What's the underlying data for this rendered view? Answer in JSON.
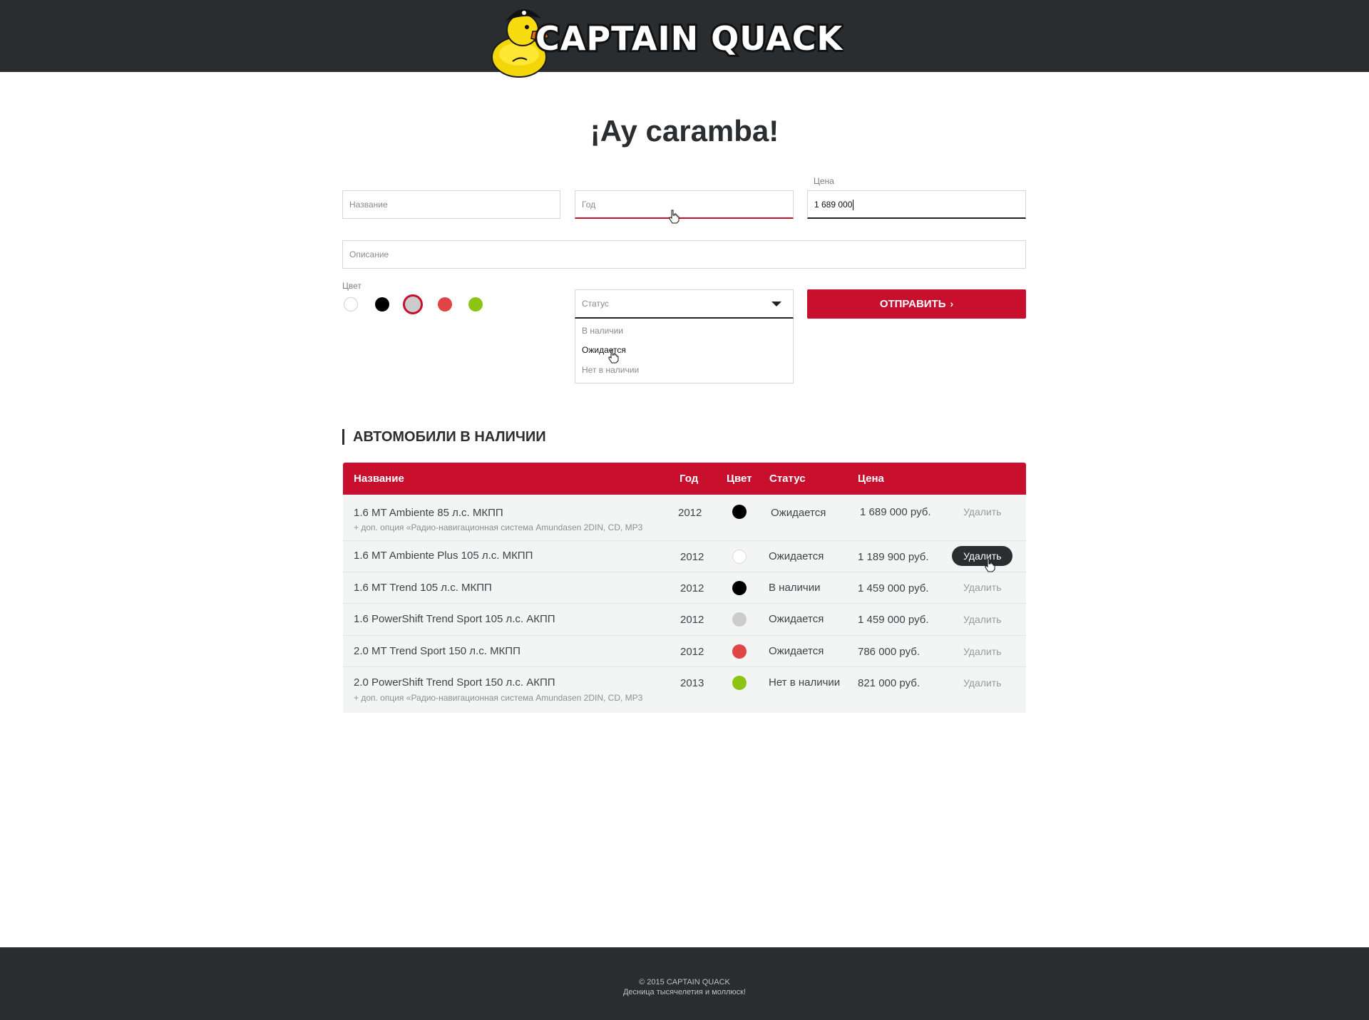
{
  "header": {
    "logo_text": "CAPTAIN QUACK"
  },
  "page_title": "¡Ay caramba!",
  "form": {
    "name_placeholder": "Название",
    "year_placeholder": "Год",
    "price_label": "Цена",
    "price_value": "1 689 000",
    "description_placeholder": "Описание",
    "color_label": "Цвет",
    "colors": [
      "#ffffff",
      "#000000",
      "#cccccc",
      "#e04444",
      "#8cc414"
    ],
    "selected_color": "#cccccc",
    "status_placeholder": "Статус",
    "status_options": [
      "В наличии",
      "Ожидается",
      "Нет в наличии"
    ],
    "status_hovered": "Ожидается",
    "submit_label": "ОТПРАВИТЬ"
  },
  "section_title": "АВТОМОБИЛИ В НАЛИЧИИ",
  "table": {
    "headers": [
      "Название",
      "Год",
      "Цвет",
      "Статус",
      "Цена"
    ],
    "rows": [
      {
        "name": "1.6 MT Ambiente 85 л.с. МКПП",
        "note": "+ доп. опция «Радио-навигационная система Amundasen 2DIN, CD, MP3",
        "year": "2012",
        "color": "#000000",
        "status": "Ожидается",
        "price": "1 689 000 руб.",
        "action": "Удалить"
      },
      {
        "name": "1.6 MT Ambiente Plus 105 л.с. МКПП",
        "note": "",
        "year": "2012",
        "color": "#ffffff",
        "status": "Ожидается",
        "price": "1 189 900 руб.",
        "action": "Удалить"
      },
      {
        "name": "1.6 MT Trend 105 л.с. МКПП",
        "note": "",
        "year": "2012",
        "color": "#000000",
        "status": "В наличии",
        "price": "1 459 000 руб.",
        "action": "Удалить"
      },
      {
        "name": "1.6 PowerShift Trend Sport 105 л.с. АКПП",
        "note": "",
        "year": "2012",
        "color": "#cccccc",
        "status": "Ожидается",
        "price": "1 459 000 руб.",
        "action": "Удалить"
      },
      {
        "name": "2.0 MT Trend Sport 150 л.с. МКПП",
        "note": "",
        "year": "2012",
        "color": "#e04444",
        "status": "Ожидается",
        "price": "786 000 руб.",
        "action": "Удалить"
      },
      {
        "name": "2.0 PowerShift Trend Sport 150 л.с. АКПП",
        "note": "+ доп. опция «Радио-навигационная система Amundasen 2DIN, CD, MP3",
        "year": "2013",
        "color": "#8cc414",
        "status": "Нет в наличии",
        "price": "821 000 руб.",
        "action": "Удалить"
      }
    ],
    "hovered_row": 1
  },
  "footer": {
    "copyright": "© 2015 CAPTAIN QUACK",
    "tagline": "Десница тысячелетия и моллюск!"
  },
  "colors": {
    "accent": "#c8102e",
    "dark": "#2a2d30"
  }
}
